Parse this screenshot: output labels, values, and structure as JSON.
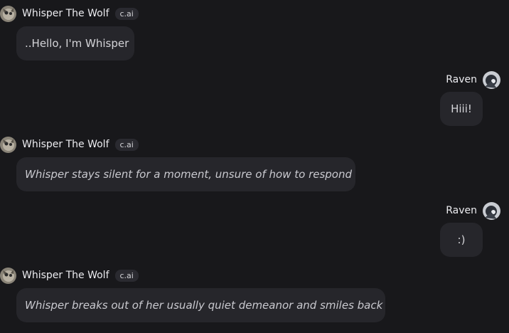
{
  "messages": [
    {
      "role": "bot",
      "author": "Whisper The Wolf",
      "badge": "c.ai",
      "avatar_icon": "wolf-avatar",
      "text": "..Hello, I'm Whisper"
    },
    {
      "role": "user",
      "author": "Raven",
      "avatar_icon": "raven-avatar",
      "text": "Hiii!"
    },
    {
      "role": "bot",
      "author": "Whisper The Wolf",
      "badge": "c.ai",
      "avatar_icon": "wolf-avatar",
      "text": "Whisper stays silent for a moment, unsure of how to respond"
    },
    {
      "role": "user",
      "author": "Raven",
      "avatar_icon": "raven-avatar",
      "text": ":)"
    },
    {
      "role": "bot",
      "author": "Whisper The Wolf",
      "badge": "c.ai",
      "avatar_icon": "wolf-avatar",
      "text": "Whisper breaks out of her usually quiet demeanor and smiles back"
    }
  ],
  "colors": {
    "background": "#18181b",
    "bubble": "#26262b",
    "text": "#d4d4d8"
  }
}
